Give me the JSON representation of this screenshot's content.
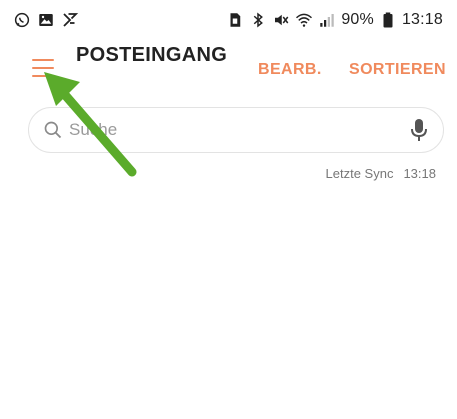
{
  "status_bar": {
    "left_icons": [
      "whatsapp-icon",
      "gallery-icon",
      "feedly-icon"
    ],
    "right_icons": [
      "sim-icon",
      "bluetooth-icon",
      "mute-vibrate-icon",
      "wifi-icon",
      "signal-icon",
      "battery-icon"
    ],
    "battery": "90%",
    "time": "13:18"
  },
  "appbar": {
    "title": "POSTEINGANG",
    "edit_label": "BEARB.",
    "sort_label": "SORTIEREN"
  },
  "search": {
    "placeholder": "Suche"
  },
  "sync": {
    "label": "Letzte Sync",
    "time": "13:18"
  },
  "colors": {
    "accent": "#f08a5d",
    "annotation_arrow": "#5bab2b"
  }
}
